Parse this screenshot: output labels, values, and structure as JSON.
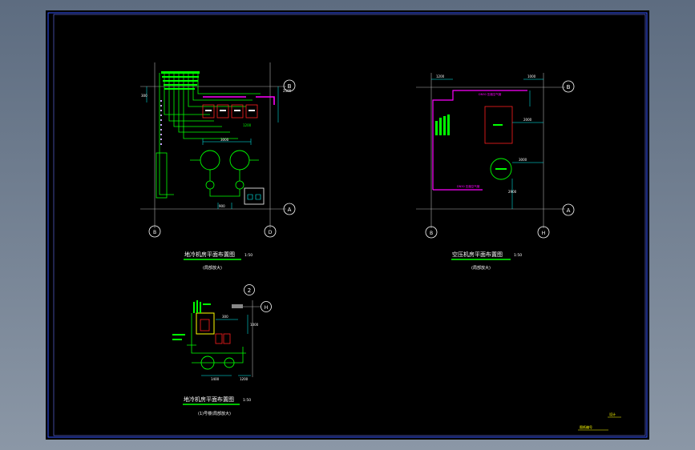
{
  "viewport": {
    "background": "#000000",
    "frame_color": "#3355ff"
  },
  "colors": {
    "grid": "#b0b0b0",
    "green": "#00ff00",
    "cyan": "#00ffff",
    "magenta": "#ff00ff",
    "white": "#ffffff",
    "yellow": "#ffff00",
    "red": "#ff2020"
  },
  "plan1": {
    "axis_top": "B",
    "axis_right": "A",
    "axis_left_bottom": "B",
    "axis_right_bottom": "D",
    "title": "地冷机房平面布置图",
    "scale": "1:50",
    "subtitle": "(局部放大)",
    "dims": [
      "2500",
      "3000",
      "1200",
      "900",
      "300"
    ]
  },
  "plan2": {
    "axis_top": "B",
    "axis_right": "A",
    "axis_left_bottom": "B",
    "axis_right_bottom": "H",
    "title": "空压机房平面布置图",
    "scale": "1:50",
    "subtitle": "(局部放大)",
    "dims": [
      "1200",
      "1000",
      "2000",
      "3000",
      "2900"
    ]
  },
  "plan3": {
    "detail_number": "2",
    "axis_right": "H",
    "title": "地冷机房平面布置图",
    "scale": "1:50",
    "subtitle": "(1)号楼(局部放大)",
    "dims": [
      "1400",
      "1200",
      "300",
      "1000"
    ]
  },
  "title_block": {
    "label_top": "设计",
    "label_bottom": "图纸编号"
  }
}
